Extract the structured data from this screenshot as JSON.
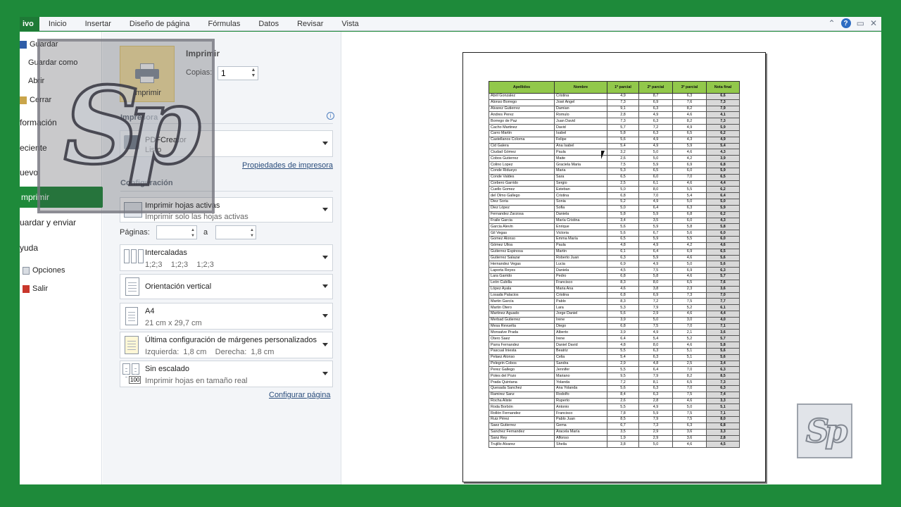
{
  "ribbon": {
    "file_tab": "ivo",
    "tabs": [
      "Inicio",
      "Insertar",
      "Diseño de página",
      "Fórmulas",
      "Datos",
      "Revisar",
      "Vista"
    ],
    "help": "?",
    "minimize": "▭",
    "close": "✕",
    "collapse": "⌃"
  },
  "nav": {
    "guardar": "Guardar",
    "guardar_como": "Guardar como",
    "abrir": "Abrir",
    "cerrar": "Cerrar",
    "informacion": "formación",
    "reciente": "eciente",
    "nuevo": "uevo",
    "imprimir": "mprimir",
    "guardar_enviar": "uardar y enviar",
    "ayuda": "yuda",
    "opciones": "Opciones",
    "salir": "Salir"
  },
  "print": {
    "heading": "Imprimir",
    "button": "Imprimir",
    "copies_label": "Copias:",
    "copies_value": "1"
  },
  "printer": {
    "section": "Impresora",
    "name": "PDFCreator",
    "status": "Listo",
    "properties_link": "Propiedades de impresora"
  },
  "config": {
    "section": "Configuración",
    "what": {
      "title": "Imprimir hojas activas",
      "sub": "Imprimir solo las hojas activas"
    },
    "pages_label": "Páginas:",
    "pages_to": "a",
    "collate": {
      "title": "Intercaladas",
      "sub": "1;2;3    1;2;3    1;2;3"
    },
    "orientation": {
      "title": "Orientación vertical"
    },
    "paper": {
      "title": "A4",
      "sub": "21 cm x 29,7 cm"
    },
    "margins": {
      "title": "Última configuración de márgenes personalizados",
      "sub": "Izquierda:  1,8 cm    Derecha:  1,8 cm"
    },
    "scaling": {
      "title": "Sin escalado",
      "sub": "Imprimir hojas en tamaño real",
      "badge": "100"
    },
    "page_setup_link": "Configurar página"
  },
  "logo": {
    "text": "Sp"
  },
  "table": {
    "headers": [
      "Apellidos",
      "Nombre",
      "1º parcial",
      "2º parcial",
      "3º parcial",
      "Nota final"
    ],
    "rows": [
      [
        "Abril Gonzalez",
        "Cristina",
        "4,9",
        "8,7",
        "6,3",
        "6,6"
      ],
      [
        "Alonso Borrego",
        "José Angel",
        "7,3",
        "6,9",
        "7,6",
        "7,3"
      ],
      [
        "Alvarez Gutierrez",
        "Damian",
        "9,1",
        "6,3",
        "8,2",
        "7,9"
      ],
      [
        "Andres Perez",
        "Romulo",
        "2,8",
        "4,9",
        "4,6",
        "4,1"
      ],
      [
        "Borrego de Paz",
        "Juan David",
        "7,3",
        "6,3",
        "8,2",
        "7,3"
      ],
      [
        "Cacho Martinez",
        "David",
        "5,7",
        "7,2",
        "4,9",
        "5,9"
      ],
      [
        "Carro Martin",
        "Isabel",
        "5,8",
        "6,3",
        "6,5",
        "6,2"
      ],
      [
        "Castellanos Colorna",
        "Felipe",
        "5,6",
        "4,9",
        "4,3",
        "4,9"
      ],
      [
        "Cid Galera",
        "Ana Isabel",
        "5,4",
        "4,9",
        "5,9",
        "5,4"
      ],
      [
        "Ciudad Gómez",
        "Paula",
        "3,2",
        "5,0",
        "4,6",
        "4,3"
      ],
      [
        "Cobos Gutierrez",
        "Maite",
        "2,6",
        "5,0",
        "4,2",
        "3,9"
      ],
      [
        "Colino Lopez",
        "Graciela Maria",
        "7,5",
        "5,9",
        "6,9",
        "6,8"
      ],
      [
        "Conde Ridueyo",
        "Maria",
        "5,3",
        "6,5",
        "6,0",
        "5,9"
      ],
      [
        "Conde Valdes",
        "Sara",
        "6,5",
        "6,0",
        "7,0",
        "6,5"
      ],
      [
        "Corbero Garrido",
        "Sergio",
        "2,5",
        "6,1",
        "4,6",
        "4,4"
      ],
      [
        "Cuello Gomez",
        "Esteban",
        "5,0",
        "8,0",
        "5,5",
        "6,2"
      ],
      [
        "del Olmo Gallego",
        "Cristina",
        "6,8",
        "7,0",
        "5,4",
        "6,4"
      ],
      [
        "Diez Soria",
        "Sonia",
        "5,2",
        "4,9",
        "5,0",
        "5,0"
      ],
      [
        "Diez López",
        "Sofia",
        "5,0",
        "6,4",
        "6,3",
        "5,9"
      ],
      [
        "Fernandez Zarzosa",
        "Daniela",
        "5,8",
        "5,9",
        "6,8",
        "6,2"
      ],
      [
        "Fraile Garcia",
        "María Cristina",
        "3,4",
        "3,5",
        "6,0",
        "4,3"
      ],
      [
        "Garcia Alevin",
        "Enrique",
        "5,6",
        "5,9",
        "5,8",
        "5,8"
      ],
      [
        "Gil Vegas",
        "Victoria",
        "5,6",
        "6,7",
        "5,6",
        "6,0"
      ],
      [
        "Gomez Alonso",
        "Emma María",
        "6,5",
        "5,9",
        "5,5",
        "6,0"
      ],
      [
        "Gómez Ulloa",
        "Paula",
        "4,8",
        "4,9",
        "4,2",
        "4,6"
      ],
      [
        "Gutierrez Espinosa",
        "Martin",
        "6,1",
        "6,4",
        "6,9",
        "6,5"
      ],
      [
        "Gutierrez Salazar",
        "Roberto Juan",
        "6,3",
        "5,9",
        "4,6",
        "5,6"
      ],
      [
        "Hernandez Vegas",
        "Lucia",
        "6,9",
        "4,9",
        "5,0",
        "5,6"
      ],
      [
        "Laporta Reyes",
        "Daniela",
        "4,5",
        "7,5",
        "6,9",
        "6,3"
      ],
      [
        "Lara Garrido",
        "Pedro",
        "6,8",
        "5,8",
        "4,6",
        "5,7"
      ],
      [
        "León Cubilla",
        "Francisco",
        "8,3",
        "8,0",
        "6,5",
        "7,6"
      ],
      [
        "López Ayala",
        "Maria Ana",
        "4,6",
        "3,8",
        "2,3",
        "3,6"
      ],
      [
        "Losada Palacios",
        "Cristina",
        "6,8",
        "6,9",
        "7,3",
        "7,0"
      ],
      [
        "Martin García",
        "Pablo",
        "8,3",
        "7,2",
        "7,5",
        "7,7"
      ],
      [
        "Martin Otero",
        "Lara",
        "5,3",
        "7,9",
        "5,2",
        "6,1"
      ],
      [
        "Martinez Aguado",
        "Jorge Daniel",
        "5,6",
        "2,9",
        "4,6",
        "4,4"
      ],
      [
        "Merbad Gutierrez",
        "Irene",
        "3,9",
        "5,0",
        "3,0",
        "4,0"
      ],
      [
        "Mesa Revuelta",
        "Diego",
        "6,8",
        "7,5",
        "7,0",
        "7,1"
      ],
      [
        "Monsalve Prada",
        "Alberto",
        "3,9",
        "4,9",
        "2,1",
        "3,6"
      ],
      [
        "Otero Saez",
        "Irene",
        "6,4",
        "5,4",
        "5,2",
        "5,7"
      ],
      [
        "Parra Fernandez",
        "Daniel David",
        "4,8",
        "8,0",
        "4,6",
        "5,8"
      ],
      [
        "Pascual Iniesta",
        "Beatriz",
        "5,5",
        "6,3",
        "5,1",
        "5,6"
      ],
      [
        "Pelaez Alonso",
        "Celia",
        "5,4",
        "6,3",
        "5,1",
        "5,6"
      ],
      [
        "Pelegrin Cobos",
        "Sandra",
        "2,9",
        "4,8",
        "2,5",
        "3,4"
      ],
      [
        "Perez Gallego",
        "Jennifer",
        "5,5",
        "6,4",
        "7,0",
        "6,3"
      ],
      [
        "Potes del Pozo",
        "Mariano",
        "9,5",
        "7,9",
        "8,2",
        "8,5"
      ],
      [
        "Prada Quintana",
        "Yolanda",
        "7,2",
        "8,1",
        "6,5",
        "7,3"
      ],
      [
        "Quesada Sanchez",
        "Ana Yolanda",
        "5,6",
        "6,3",
        "7,0",
        "6,3"
      ],
      [
        "Ramirez Sanz",
        "Rodolfo",
        "8,4",
        "6,3",
        "7,5",
        "7,4"
      ],
      [
        "Rocha Aliste",
        "Ruperto",
        "2,6",
        "2,8",
        "4,6",
        "3,3"
      ],
      [
        "Roda Borbón",
        "Antonio",
        "5,5",
        "4,9",
        "5,0",
        "5,1"
      ],
      [
        "Rollón Fernandez",
        "Francisco",
        "7,8",
        "5,9",
        "7,5",
        "7,1"
      ],
      [
        "Ruiz Pérez",
        "Pablo Juan",
        "8,5",
        "7,9",
        "7,5",
        "8,0"
      ],
      [
        "Saez Gutierrez",
        "Gema",
        "6,7",
        "7,3",
        "6,3",
        "6,8"
      ],
      [
        "Sanchez Fernandez",
        "Aracela María",
        "3,5",
        "2,9",
        "3,6",
        "3,3"
      ],
      [
        "Sanz Rey",
        "Alfonso",
        "1,9",
        "2,9",
        "3,6",
        "2,8"
      ],
      [
        "Trujillo Alvarez",
        "Sheila",
        "3,8",
        "5,0",
        "4,6",
        "4,5"
      ]
    ]
  }
}
